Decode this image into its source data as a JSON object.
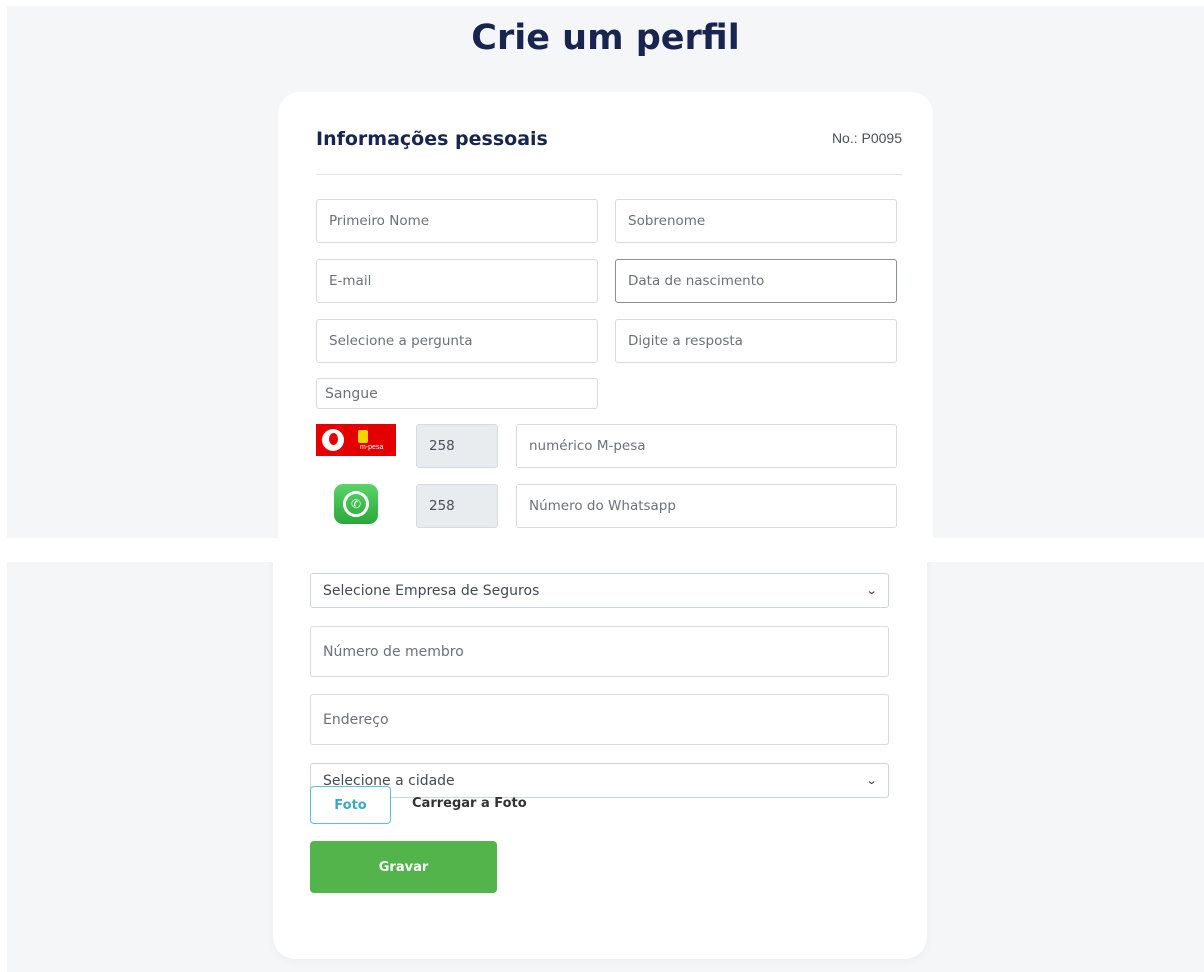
{
  "page": {
    "title": "Crie um perfil"
  },
  "section": {
    "title": "Informações pessoais",
    "profile_no": "No.: P0095"
  },
  "fields": {
    "first_name": "Primeiro Nome",
    "last_name": "Sobrenome",
    "email": "E-mail",
    "birth_date": "Data de nascimento",
    "question": "Selecione a pergunta",
    "answer": "Digite a resposta",
    "blood": "Sangue",
    "mpesa_prefix": "258",
    "mpesa_number": "numérico M-pesa",
    "whatsapp_prefix": "258",
    "whatsapp_number": "Número do Whatsapp",
    "insurance_select": "Selecione Empresa de Seguros",
    "member_number": "Número de membro",
    "address": "Endereço",
    "city_select": "Selecione a cidade"
  },
  "logos": {
    "mpesa_text": "m-pesa"
  },
  "actions": {
    "photo": "Foto",
    "upload_label": "Carregar a Foto",
    "save": "Gravar"
  },
  "colors": {
    "title": "#17254f",
    "save": "#52b44b",
    "photo_border": "#5bc0de",
    "mpesa": "#e40000",
    "whatsapp": "#2aa83a"
  }
}
